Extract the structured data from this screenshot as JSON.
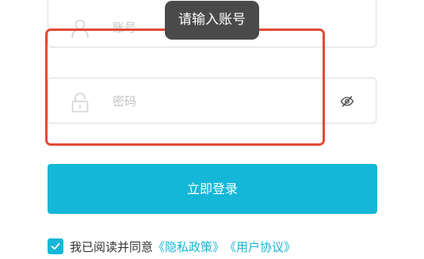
{
  "account": {
    "placeholder": "账号",
    "value": "",
    "icon": "user-icon"
  },
  "tooltip": {
    "text": "请输入账号"
  },
  "password": {
    "placeholder": "密码",
    "value": "",
    "icon": "lock-icon",
    "toggle_icon": "eye-slash-icon"
  },
  "login_button": {
    "label": "立即登录"
  },
  "agreement": {
    "checked": true,
    "text": "我已阅读并同意",
    "privacy_link": "《隐私政策》",
    "terms_link": "《用户协议》"
  },
  "colors": {
    "accent": "#14b7d7",
    "highlight": "#e34a35",
    "tooltip_bg": "#4a4a4a",
    "placeholder": "#c3c3c3",
    "border": "#dddddd"
  }
}
